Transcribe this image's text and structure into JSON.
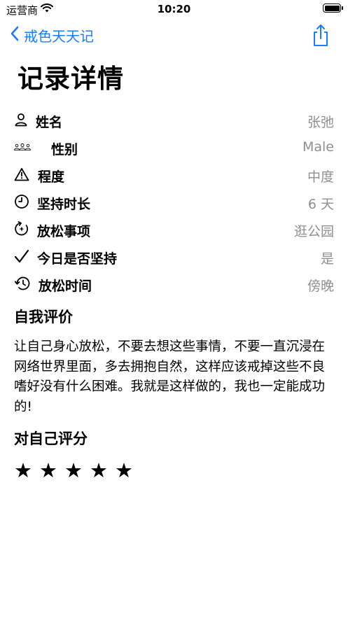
{
  "status": {
    "carrier": "运营商",
    "time": "10:20"
  },
  "nav": {
    "back_label": "戒色天天记"
  },
  "page": {
    "title": "记录详情"
  },
  "fields": [
    {
      "label": "姓名",
      "value": "张弛",
      "icon": "person-icon"
    },
    {
      "label": "性别",
      "value": "Male",
      "icon": "people-icon"
    },
    {
      "label": "程度",
      "value": "中度",
      "icon": "warning-icon"
    },
    {
      "label": "坚持时长",
      "value": "6 天",
      "icon": "clock-icon"
    },
    {
      "label": "放松事项",
      "value": "逛公园",
      "icon": "refresh-icon"
    },
    {
      "label": "今日是否坚持",
      "value": "是",
      "icon": "checkmark-icon"
    },
    {
      "label": "放松时间",
      "value": "傍晚",
      "icon": "history-icon"
    }
  ],
  "self_eval": {
    "heading": "自我评价",
    "text": "让自己身心放松，不要去想这些事情，不要一直沉浸在网络世界里面，多去拥抱自然，这样应该戒掉这些不良嗜好没有什么困难。我就是这样做的，我也一定能成功的!"
  },
  "rating": {
    "heading": "对自己评分",
    "value": 5,
    "max": 5,
    "star_glyph": "★"
  }
}
